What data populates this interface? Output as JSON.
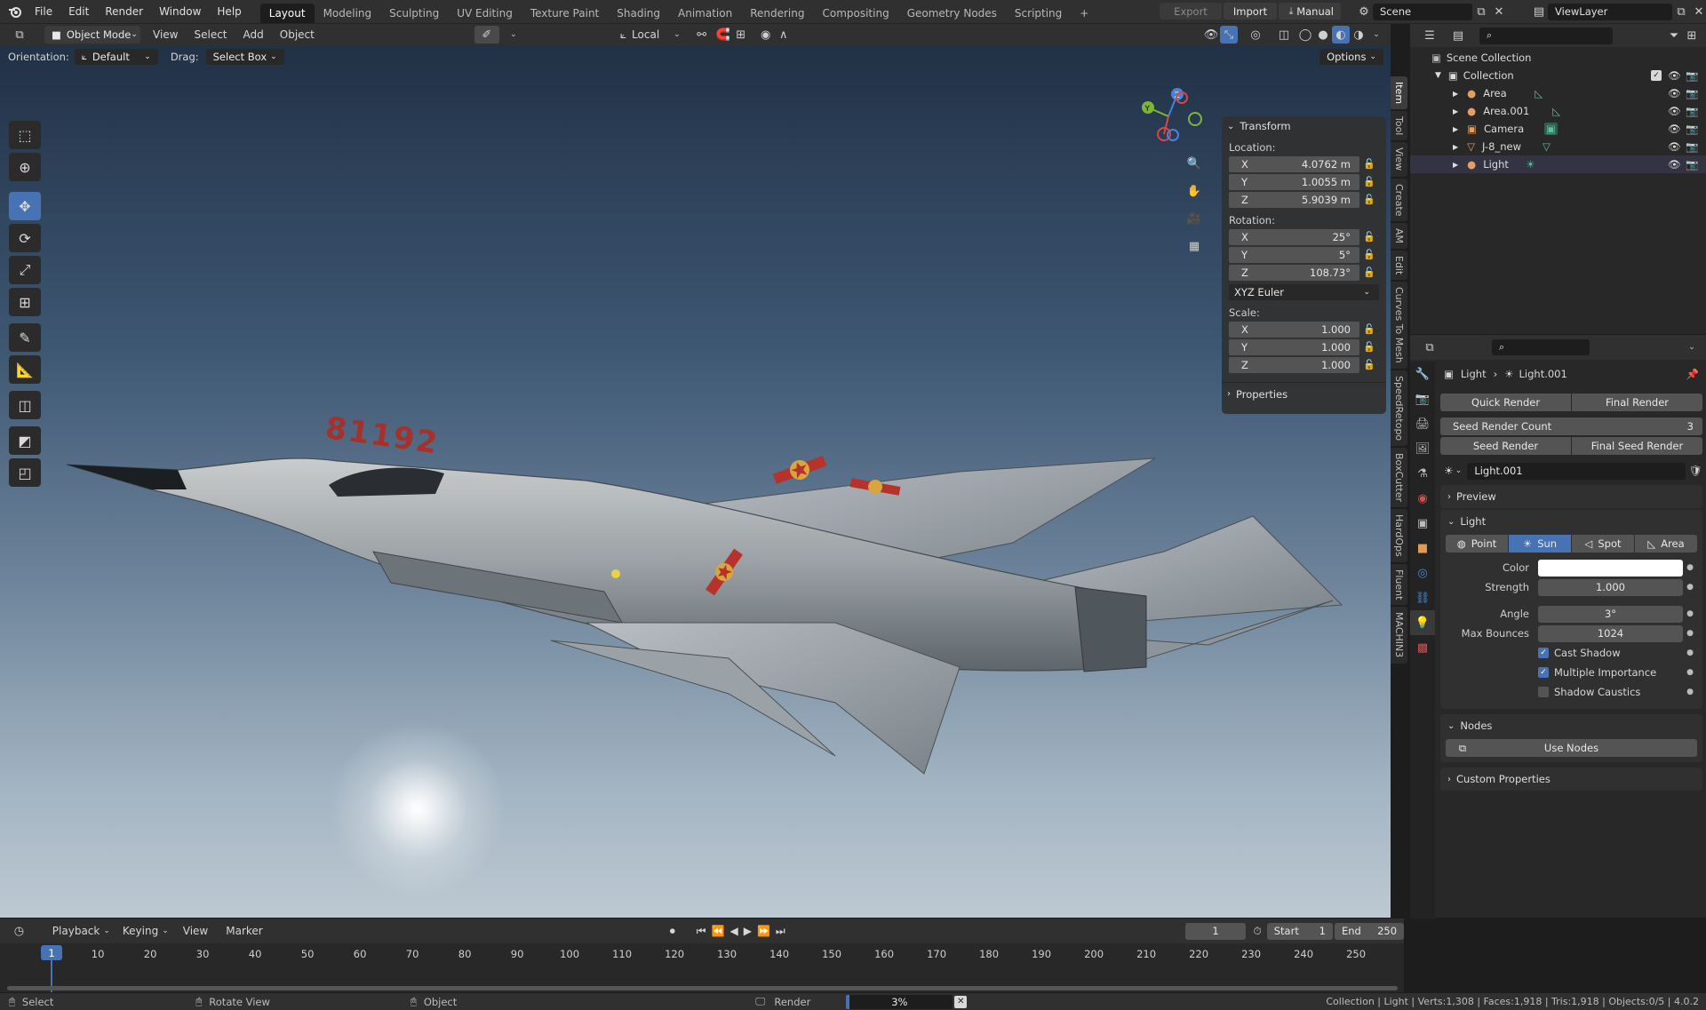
{
  "topbar": {
    "menus": [
      "File",
      "Edit",
      "Render",
      "Window",
      "Help"
    ],
    "workspaces": [
      "Layout",
      "Modeling",
      "Sculpting",
      "UV Editing",
      "Texture Paint",
      "Shading",
      "Animation",
      "Rendering",
      "Compositing",
      "Geometry Nodes",
      "Scripting"
    ],
    "active_workspace": "Layout",
    "add_tab": "+",
    "export_label": "Export",
    "import_label": "Import",
    "manual_label": "Manual",
    "scene_label": "Scene",
    "viewlayer_label": "ViewLayer"
  },
  "viewport_header": {
    "mode": "Object Mode",
    "menus": [
      "View",
      "Select",
      "Add",
      "Object"
    ],
    "transform_orientation": "Local",
    "orientation_label": "Orientation:",
    "orientation_value": "Default",
    "drag_label": "Drag:",
    "drag_value": "Select Box",
    "options_label": "Options"
  },
  "toolbar": {
    "tools": [
      "select-box",
      "cursor",
      "move",
      "rotate",
      "scale",
      "transform",
      "annotate",
      "measure",
      "add-cube",
      "tool-extra-1",
      "tool-extra-2"
    ],
    "active_tool": "move"
  },
  "model": {
    "tail_number": "81192"
  },
  "npanel": {
    "title": "Transform",
    "location_label": "Location:",
    "location": [
      {
        "axis": "X",
        "value": "4.0762 m"
      },
      {
        "axis": "Y",
        "value": "1.0055 m"
      },
      {
        "axis": "Z",
        "value": "5.9039 m"
      }
    ],
    "rotation_label": "Rotation:",
    "rotation": [
      {
        "axis": "X",
        "value": "25°"
      },
      {
        "axis": "Y",
        "value": "5°"
      },
      {
        "axis": "Z",
        "value": "108.73°"
      }
    ],
    "rotation_mode": "XYZ Euler",
    "scale_label": "Scale:",
    "scale": [
      {
        "axis": "X",
        "value": "1.000"
      },
      {
        "axis": "Y",
        "value": "1.000"
      },
      {
        "axis": "Z",
        "value": "1.000"
      }
    ],
    "properties_label": "Properties",
    "side_tabs": [
      "Item",
      "Tool",
      "View",
      "Create",
      "AM",
      "Edit",
      "Curves To Mesh",
      "SpeedRetopo",
      "BoxCutter",
      "HardOps",
      "Fluent",
      "MACHIN3"
    ],
    "active_side_tab": "Item"
  },
  "outliner": {
    "root": "Scene Collection",
    "collection": "Collection",
    "items": [
      {
        "name": "Area",
        "icon": "light-area-icon"
      },
      {
        "name": "Area.001",
        "icon": "light-area-icon"
      },
      {
        "name": "Camera",
        "icon": "camera-icon"
      },
      {
        "name": "J-8_new",
        "icon": "mesh-icon"
      },
      {
        "name": "Light",
        "icon": "sun-icon"
      }
    ]
  },
  "properties": {
    "breadcrumb_object": "Light",
    "breadcrumb_data": "Light.001",
    "quick_render": "Quick Render",
    "final_render": "Final Render",
    "seed_render_count_label": "Seed Render Count",
    "seed_render_count_value": "3",
    "seed_render": "Seed Render",
    "final_seed_render": "Final Seed Render",
    "datablock": "Light.001",
    "preview_label": "Preview",
    "light_label": "Light",
    "light_types": [
      "Point",
      "Sun",
      "Spot",
      "Area"
    ],
    "active_light_type": "Sun",
    "color_label": "Color",
    "color_value": "#ffffff",
    "strength_label": "Strength",
    "strength_value": "1.000",
    "angle_label": "Angle",
    "angle_value": "3°",
    "max_bounces_label": "Max Bounces",
    "max_bounces_value": "1024",
    "cast_shadow": "Cast Shadow",
    "multiple_importance": "Multiple Importance",
    "shadow_caustics": "Shadow Caustics",
    "nodes_label": "Nodes",
    "use_nodes": "Use Nodes",
    "custom_properties": "Custom Properties"
  },
  "timeline": {
    "menus": [
      "Playback",
      "Keying",
      "View",
      "Marker"
    ],
    "current_frame": "1",
    "start_label": "Start",
    "start_value": "1",
    "end_label": "End",
    "end_value": "250",
    "ticks": [
      "1",
      "10",
      "20",
      "30",
      "40",
      "50",
      "60",
      "70",
      "80",
      "90",
      "100",
      "110",
      "120",
      "130",
      "140",
      "150",
      "160",
      "170",
      "180",
      "190",
      "200",
      "210",
      "220",
      "230",
      "240",
      "250"
    ]
  },
  "statusbar": {
    "select": "Select",
    "rotate_view": "Rotate View",
    "object": "Object",
    "render_label": "Render",
    "render_progress": "3%",
    "stats": "Collection | Light | Verts:1,308 | Faces:1,918 | Tris:1,918 | Objects:0/5 | 4.0.2"
  },
  "colors": {
    "accent": "#4772b3",
    "bg": "#303030",
    "field": "#545454"
  }
}
